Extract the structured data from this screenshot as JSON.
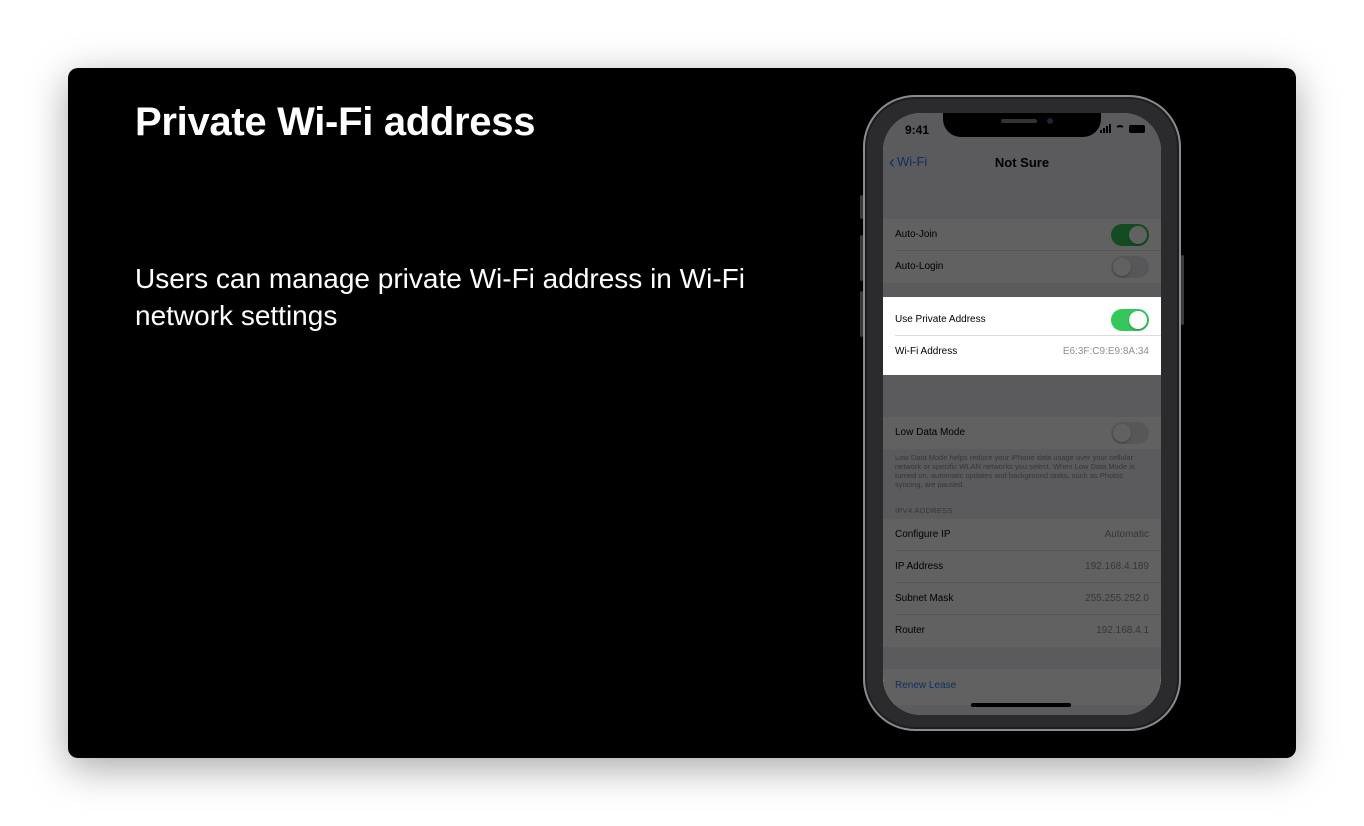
{
  "slide": {
    "title": "Private Wi-Fi address",
    "body": "Users can manage private Wi-Fi address in Wi-Fi network settings"
  },
  "phone": {
    "status_time": "9:41",
    "nav": {
      "back_label": "Wi-Fi",
      "title": "Not Sure"
    },
    "rows": {
      "auto_join": {
        "label": "Auto-Join",
        "toggle": "on"
      },
      "auto_login": {
        "label": "Auto-Login",
        "toggle": "off"
      },
      "use_private_address": {
        "label": "Use Private Address",
        "toggle": "on"
      },
      "wifi_address": {
        "label": "Wi-Fi Address",
        "value": "E6:3F:C9:E9:8A:34"
      },
      "low_data_mode": {
        "label": "Low Data Mode",
        "toggle": "off"
      }
    },
    "low_data_footnote": "Low Data Mode helps reduce your iPhone data usage over your cellular network or specific WLAN networks you select. When Low Data Mode is turned on, automatic updates and background tasks, such as Photos syncing, are paused.",
    "ipv4_header": "IPV4 ADDRESS",
    "ipv4": {
      "configure_ip": {
        "label": "Configure IP",
        "value": "Automatic"
      },
      "ip_address": {
        "label": "IP Address",
        "value": "192.168.4.189"
      },
      "subnet_mask": {
        "label": "Subnet Mask",
        "value": "255.255.252.0"
      },
      "router": {
        "label": "Router",
        "value": "192.168.4.1"
      }
    },
    "renew_lease": "Renew Lease"
  },
  "colors": {
    "toggle_on": "#34c759",
    "link_blue": "#2f7bf6",
    "slide_bg": "#000000"
  }
}
